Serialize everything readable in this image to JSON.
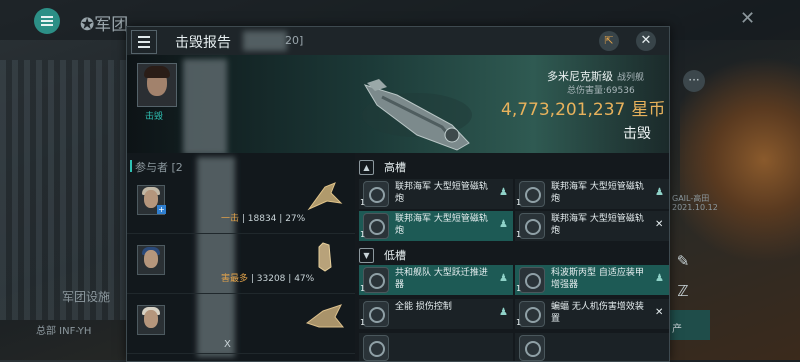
{
  "background": {
    "title": "军团",
    "labels": [
      "军团设施",
      "总部 INF-YH",
      "产",
      "GAIL-高田",
      "2021.10.12"
    ]
  },
  "panel": {
    "title": "击毁报告",
    "id_suffix": "20]",
    "victim": {
      "tag": "击毁"
    },
    "ship": {
      "name": "多米尼克斯级",
      "class": "战列舰",
      "damage_label": "总伤害量:",
      "damage_value": "69536",
      "isk_value": "4,773,201,237",
      "currency": "星币",
      "result": "击毁"
    },
    "participants": {
      "header": "参与者 [2",
      "rows": [
        {
          "stat_label": "一击",
          "damage": "18834",
          "percent": "27%"
        },
        {
          "stat_label": "害最多",
          "damage": "33208",
          "percent": "47%"
        },
        {
          "stat_label": "",
          "damage": "",
          "percent": "",
          "extra": "X"
        }
      ]
    },
    "fitting": {
      "high_slots": {
        "title": "高槽",
        "modules": [
          {
            "qty": "1",
            "name": "联邦海军 大型短管磁轨炮",
            "state": "person",
            "highlight": false
          },
          {
            "qty": "1",
            "name": "联邦海军 大型短管磁轨炮",
            "state": "person",
            "highlight": true
          },
          {
            "qty": "1",
            "name": "联邦海军 大型短管磁轨炮",
            "state": "x",
            "highlight": false
          },
          {
            "qty": "1",
            "name": "联邦海军 大型短管磁轨炮",
            "state": "person",
            "highlight": false
          }
        ]
      },
      "low_slots": {
        "title": "低槽",
        "modules": [
          {
            "qty": "1",
            "name": "共和舰队 大型跃迁推进器",
            "state": "person",
            "highlight": true
          },
          {
            "qty": "1",
            "name": "科波斯丙型 自适应装甲增强器",
            "state": "person",
            "highlight": true
          },
          {
            "qty": "1",
            "name": "全能 损伤控制",
            "state": "person",
            "highlight": false
          },
          {
            "qty": "1",
            "name": "蝙蝠 无人机伤害增效装置",
            "state": "x",
            "highlight": false
          }
        ]
      }
    }
  }
}
